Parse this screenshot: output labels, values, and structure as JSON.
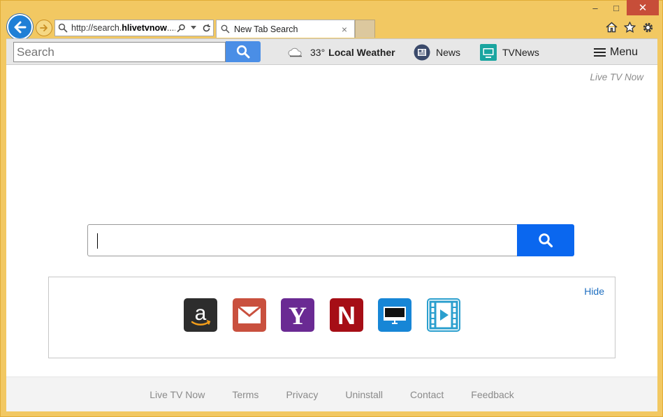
{
  "browser": {
    "url_prefix": "http://search.",
    "url_domain": "hlivetvnow",
    "url_suffix": "....",
    "tab_title": "New Tab Search",
    "tab_close": "×",
    "window_controls": {
      "minimize": "–",
      "maximize": "□",
      "close": "✕"
    }
  },
  "toolbar": {
    "search_placeholder": "Search",
    "weather_temp": "33°",
    "weather_label": "Local Weather",
    "news_label": "News",
    "tvnews_label": "TVNews",
    "menu_label": "Menu"
  },
  "page": {
    "brand_link": "Live TV Now",
    "search_value": "",
    "shortcuts_hide": "Hide",
    "shortcuts": [
      {
        "name": "amazon",
        "icon": "amazon-icon",
        "glyph": "a",
        "color": "#2d2d2d"
      },
      {
        "name": "gmail",
        "icon": "mail-icon",
        "glyph": "",
        "color": "#c9503e"
      },
      {
        "name": "yahoo",
        "icon": "yahoo-icon",
        "glyph": "Y",
        "color": "#6a2a93"
      },
      {
        "name": "netflix",
        "icon": "netflix-icon",
        "glyph": "N",
        "color": "#a60e16"
      },
      {
        "name": "tv",
        "icon": "monitor-icon",
        "glyph": "",
        "color": "#1786d6"
      },
      {
        "name": "video",
        "icon": "video-icon",
        "glyph": "",
        "color": "#2b9fce"
      }
    ]
  },
  "footer": {
    "links": [
      "Live TV Now",
      "Terms",
      "Privacy",
      "Uninstall",
      "Contact",
      "Feedback"
    ]
  },
  "colors": {
    "frame": "#f2c862",
    "search_button": "#0a67ef",
    "toolbar_search_button": "#4a8ee6",
    "link_blue": "#1f6fc0"
  }
}
